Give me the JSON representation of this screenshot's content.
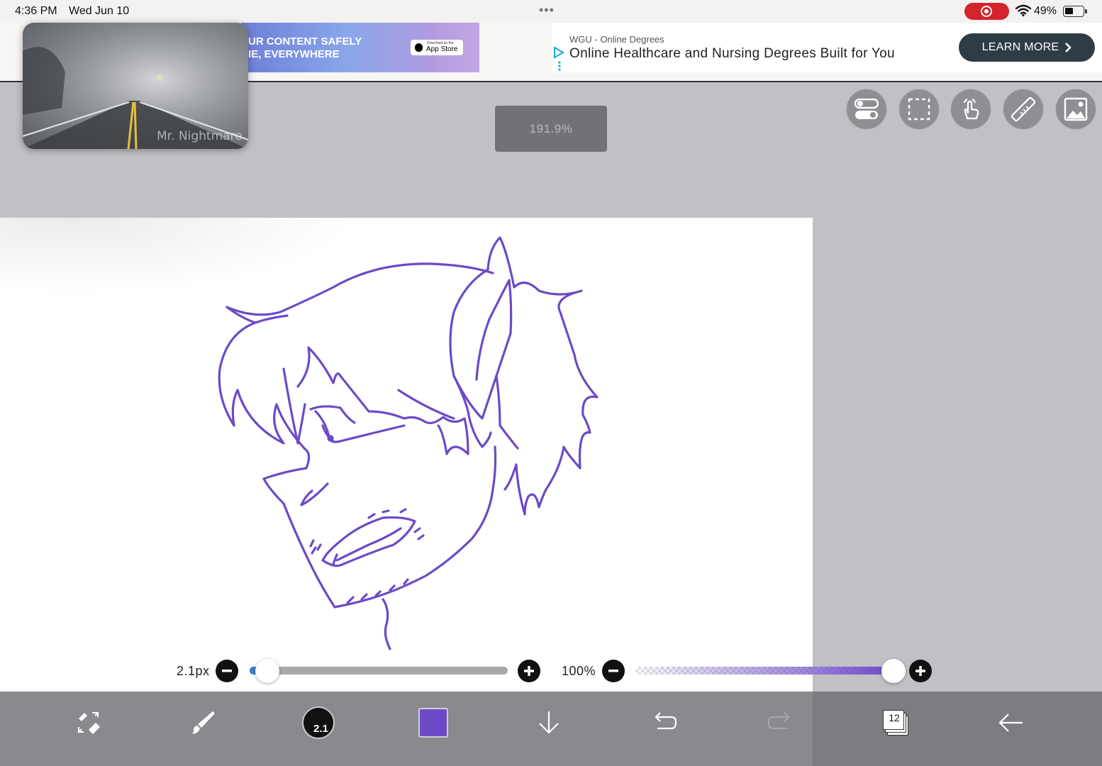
{
  "status_bar": {
    "time": "4:36 PM",
    "date": "Wed Jun 10",
    "battery_percent": "49%",
    "battery_level": 0.49,
    "recording": true
  },
  "ad": {
    "left_banner": {
      "line1": "UR CONTENT SAFELY",
      "line2": "IE, EVERYWHERE",
      "badge_small": "Download on the",
      "badge_big": "App Store"
    },
    "source": "WGU - Online Degrees",
    "headline": "Online Healthcare and Nursing Degrees Built for You",
    "cta_label": "LEARN MORE"
  },
  "pip_video": {
    "caption": "Mr. Nightmare"
  },
  "zoom_level": "191.9%",
  "toolbar_top": {
    "icons": [
      "toggle-icon",
      "selection-icon",
      "touch-icon",
      "ruler-icon",
      "image-import-icon"
    ]
  },
  "brush": {
    "size_label": "2.1px",
    "size_fraction": 0.07,
    "opacity_label": "100%",
    "opacity_fraction": 1.0,
    "color": "#6c4ac8"
  },
  "bottom_toolbar": {
    "brush_size_badge": "2.1",
    "current_color": "#6c4ac8",
    "layers_count": "12",
    "icons": [
      "transform-icon",
      "brush-icon",
      "brush-size-icon",
      "color-swatch",
      "download-icon",
      "undo-icon",
      "redo-icon",
      "layers-icon",
      "back-icon"
    ]
  }
}
